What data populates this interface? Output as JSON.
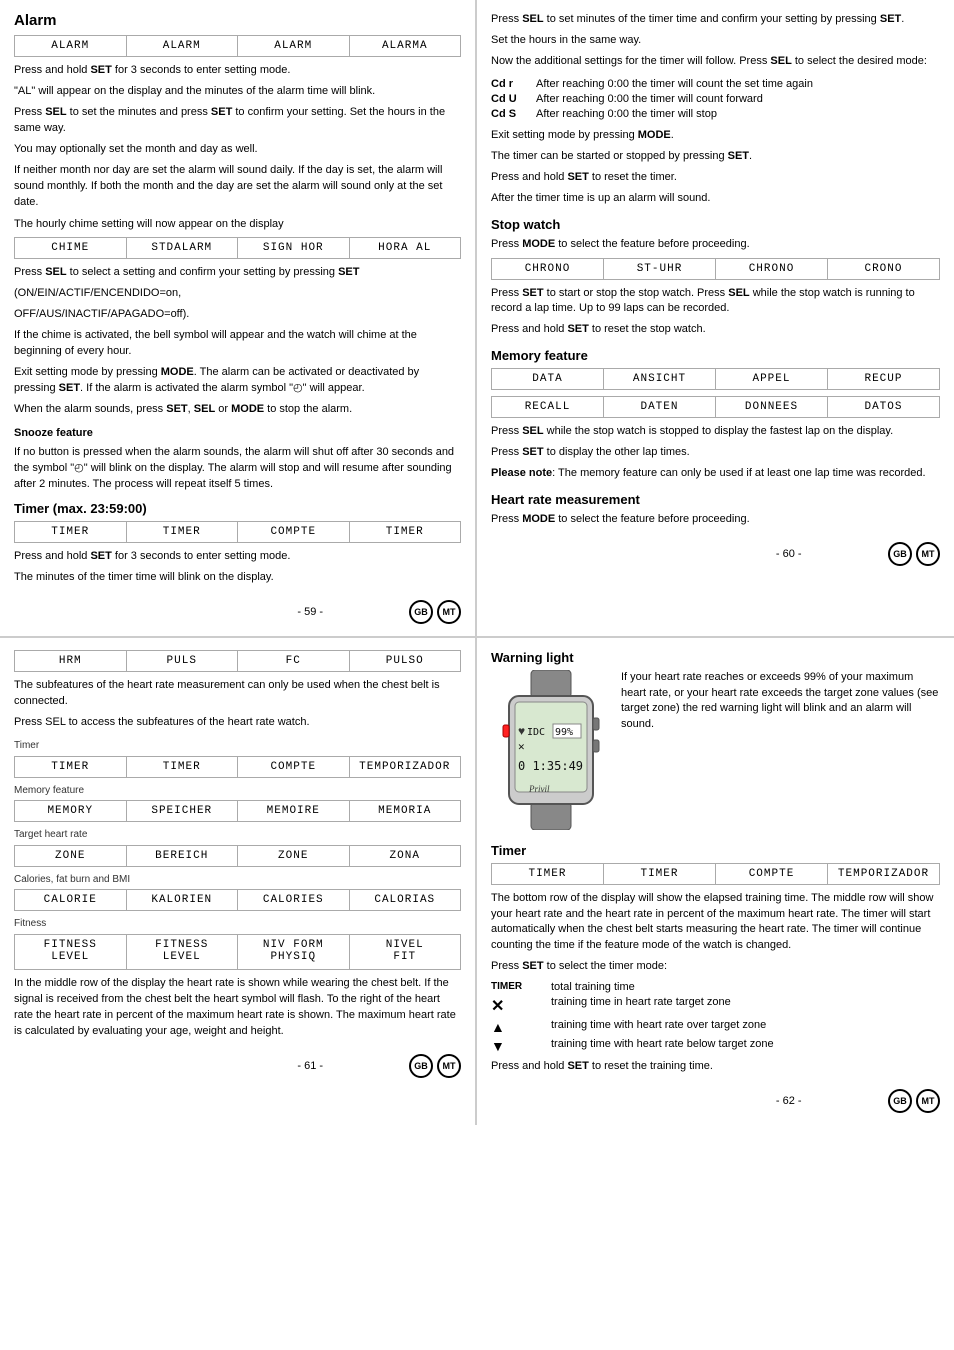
{
  "top": {
    "left": {
      "title": "Alarm",
      "display_rows": [
        {
          "cells": [
            {
              "text": "ALARM",
              "shaded": false
            },
            {
              "text": "ALARM",
              "shaded": false
            },
            {
              "text": "ALARM",
              "shaded": false
            },
            {
              "text": "ALARMA",
              "shaded": false
            }
          ]
        }
      ],
      "paragraphs": [
        "Press and hold SET for 3 seconds to enter setting mode.",
        "\"AL\" will appear on the display and the minutes of the alarm time will blink.",
        "Press SEL to set the minutes and press SET to confirm your setting. Set the hours in the same way.",
        "You may optionally set the month and day as well.",
        "If neither month nor day are set the alarm will sound daily. If the day is set, the alarm will sound monthly. If both the month and the day are set the alarm will sound only at the set date."
      ],
      "chime_label": "The hourly chime setting will now appear on the display",
      "chime_row": {
        "cells": [
          {
            "text": "CHIME",
            "shaded": false
          },
          {
            "text": "STDALARM",
            "shaded": false
          },
          {
            "text": "SIGN HOR",
            "shaded": false
          },
          {
            "text": "HORA AL",
            "shaded": false
          }
        ]
      },
      "chime_para1": "Press SEL to select a setting and confirm your setting by pressing SET",
      "chime_on": "(ON/EIN/ACTIF/ENCENDIDO=on,",
      "chime_off": "OFF/AUS/INACTIF/APAGADO=off).",
      "chime_para2": "If the chime is activated, the bell symbol will appear and the watch will chime at the beginning of every hour.",
      "chime_para3": "Exit setting mode by pressing MODE. The alarm can be activated or deactivated by pressing SET. If the alarm is activated the alarm symbol will appear.",
      "chime_para4": "When the alarm sounds, press SET, SEL or MODE to stop the alarm.",
      "snooze": {
        "label": "Snooze feature",
        "para1": "If no button is pressed when the alarm sounds, the alarm will shut off after 30 seconds and the symbol will blink on the display. The alarm will stop and will resume after sounding after 2 minutes. The process will repeat itself 5 times."
      },
      "timer": {
        "title": "Timer (max. 23:59:00)",
        "display_row": {
          "cells": [
            {
              "text": "TIMER",
              "shaded": false
            },
            {
              "text": "TIMER",
              "shaded": false
            },
            {
              "text": "COMPTE",
              "shaded": false
            },
            {
              "text": "TIMER",
              "shaded": false
            }
          ]
        },
        "para1": "Press and hold SET for 3 seconds to enter setting mode.",
        "para2": "The minutes of the timer time will blink on the display."
      },
      "page_num": "- 59 -"
    },
    "right": {
      "paras": [
        "Press SEL to set minutes of the timer time and confirm your setting by pressing SET.",
        "Set the hours in the same way.",
        "Now the additional settings for the timer will follow. Press SEL to select the desired mode:"
      ],
      "modes": [
        {
          "code": "Cd r",
          "desc": "After reaching 0:00 the timer will count the set time again"
        },
        {
          "code": "Cd U",
          "desc": "After reaching 0:00 the timer will count forward"
        },
        {
          "code": "Cd S",
          "desc": "After reaching 0:00 the timer will stop"
        }
      ],
      "modes_paras": [
        "Exit setting mode by pressing MODE.",
        "The timer can be started or stopped by pressing SET.",
        "Press and hold SET to reset the timer.",
        "After the timer time is up an alarm will sound."
      ],
      "stopwatch": {
        "title": "Stop watch",
        "para1": "Press MODE to select the feature before proceeding.",
        "display_row": {
          "cells": [
            {
              "text": "CHRONO",
              "shaded": false
            },
            {
              "text": "ST-UHR",
              "shaded": false
            },
            {
              "text": "CHRONO",
              "shaded": false
            },
            {
              "text": "CRONO",
              "shaded": false
            }
          ]
        },
        "para2": "Press SET to start or stop the stop watch. Press SEL while the stop watch is running to record a lap time. Up to 99 laps can be recorded.",
        "para3": "Press and hold SET to reset the stop watch."
      },
      "memory": {
        "title": "Memory feature",
        "display_row": {
          "cells": [
            {
              "text": "DATA",
              "shaded": false
            },
            {
              "text": "ANSICHT",
              "shaded": false
            },
            {
              "text": "APPEL",
              "shaded": false
            },
            {
              "text": "RECUP",
              "shaded": false
            }
          ]
        },
        "display_row2": {
          "cells": [
            {
              "text": "RECALL",
              "shaded": false
            },
            {
              "text": "DATEN",
              "shaded": false
            },
            {
              "text": "DONNEES",
              "shaded": false
            },
            {
              "text": "DATOS",
              "shaded": false
            }
          ]
        },
        "para1": "Press SEL while the stop watch is stopped to display the fastest lap on the display.",
        "para2": "Press SET to display the other lap times.",
        "note": "Please note: The memory feature can only be used if at least one lap time was recorded."
      },
      "heart_rate": {
        "title": "Heart rate measurement",
        "para1": "Press MODE to select the feature before proceeding."
      },
      "page_num": "- 60 -"
    }
  },
  "bottom": {
    "left": {
      "display_row_top": {
        "cells": [
          {
            "text": "HRM",
            "shaded": false
          },
          {
            "text": "PULS",
            "shaded": false
          },
          {
            "text": "FC",
            "shaded": false
          },
          {
            "text": "PULSO",
            "shaded": false
          }
        ]
      },
      "para1": "The subfeatures of the heart rate measurement can only be used when the chest belt is connected.",
      "para2": "Press SEL to access the subfeatures of the heart rate watch.",
      "subfeatures": [
        {
          "label": "Timer",
          "cells": [
            {
              "text": "TIMER",
              "shaded": false
            },
            {
              "text": "TIMER",
              "shaded": false
            },
            {
              "text": "COMPTE",
              "shaded": false
            },
            {
              "text": "TEMPORIZADOR",
              "shaded": false
            }
          ]
        },
        {
          "label": "Memory feature",
          "cells": [
            {
              "text": "MEMORY",
              "shaded": false
            },
            {
              "text": "SPEICHER",
              "shaded": false
            },
            {
              "text": "MEMOIRE",
              "shaded": false
            },
            {
              "text": "MEMORIA",
              "shaded": false
            }
          ]
        },
        {
          "label": "Target heart rate",
          "cells": [
            {
              "text": "ZONE",
              "shaded": false
            },
            {
              "text": "BEREICH",
              "shaded": false
            },
            {
              "text": "ZONE",
              "shaded": false
            },
            {
              "text": "ZONA",
              "shaded": false
            }
          ]
        },
        {
          "label": "Calories, fat burn and BMI",
          "cells": [
            {
              "text": "CALORIE",
              "shaded": false
            },
            {
              "text": "KALORIEN",
              "shaded": false
            },
            {
              "text": "CALORIES",
              "shaded": false
            },
            {
              "text": "CALORIAS",
              "shaded": false
            }
          ]
        },
        {
          "label": "Fitness",
          "cells": [
            {
              "text": "FITNESS\nLEVEL",
              "shaded": false
            },
            {
              "text": "FITNESS\nLEVEL",
              "shaded": false
            },
            {
              "text": "NIV FORM\nPHYSIQ",
              "shaded": false
            },
            {
              "text": "NIVEL\nFIT",
              "shaded": false
            }
          ]
        }
      ],
      "description": "In the middle row of the display the heart rate is shown while wearing the chest belt. If the signal is received from the chest belt the heart symbol will flash. To the right of the heart rate the heart rate in percent of the maximum heart rate is shown. The maximum heart rate is calculated by evaluating your age, weight and height.",
      "page_num": "- 61 -"
    },
    "right": {
      "warning": {
        "title": "Warning light",
        "description": "If your heart rate reaches or exceeds 99% of your maximum heart rate, or your heart rate exceeds the target zone values (see target zone) the red warning light will blink and an alarm will sound."
      },
      "timer": {
        "title": "Timer",
        "display_row": {
          "cells": [
            {
              "text": "TIMER",
              "shaded": false
            },
            {
              "text": "TIMER",
              "shaded": false
            },
            {
              "text": "COMPTE",
              "shaded": false
            },
            {
              "text": "TEMPORIZADOR",
              "shaded": false
            }
          ]
        },
        "para1": "The bottom row of the display will show the elapsed training time. The middle row will show your heart rate and the heart rate in percent of the maximum heart rate. The timer will start automatically when the chest belt starts measuring the heart rate. The timer will continue counting the time if the feature mode of the watch is changed.",
        "para2": "Press SET to select the timer mode:",
        "items": [
          {
            "icon": "TIMER",
            "label": "TIMER",
            "desc": "total training time"
          },
          {
            "icon": "X",
            "label": "",
            "desc": "training time in heart rate target zone"
          },
          {
            "icon": "▲",
            "label": "",
            "desc": "training time with heart rate over target zone"
          },
          {
            "icon": "▼",
            "label": "",
            "desc": "training time with heart rate below target zone"
          }
        ],
        "hold_note": "Press and hold SET to reset the training time."
      },
      "page_num": "- 62 -"
    }
  },
  "badges": {
    "gb": "GB",
    "mt": "MT"
  }
}
